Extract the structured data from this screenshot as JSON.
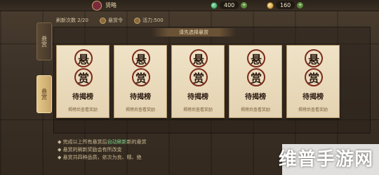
{
  "topbar": {
    "player_name": "贤略",
    "resources": [
      {
        "icon": "jade-gem-icon",
        "value": "400"
      },
      {
        "icon": "coin-icon",
        "value": "160"
      }
    ]
  },
  "side_tabs": [
    {
      "label": "悬赏",
      "active": false
    },
    {
      "label": "悬赏",
      "active": true
    }
  ],
  "info": {
    "refresh_label": "刷新次数 2/20",
    "bounty_label": "悬赏令",
    "vigor_label": "活力:500"
  },
  "banner": "请先选择悬赏",
  "cards": [
    {
      "seal_top": "悬",
      "seal_bottom": "赏",
      "title": "待揭榜",
      "subtitle": "揭榜后查看奖励"
    },
    {
      "seal_top": "悬",
      "seal_bottom": "赏",
      "title": "待揭榜",
      "subtitle": "揭榜后查看奖励"
    },
    {
      "seal_top": "悬",
      "seal_bottom": "赏",
      "title": "待揭榜",
      "subtitle": "揭榜后查看奖励"
    },
    {
      "seal_top": "悬",
      "seal_bottom": "赏",
      "title": "待揭榜",
      "subtitle": "揭榜后查看奖励"
    },
    {
      "seal_top": "悬",
      "seal_bottom": "赏",
      "title": "待揭榜",
      "subtitle": "揭榜后查看奖励"
    }
  ],
  "notes": [
    {
      "prefix": "◆ 完成以上所有悬赏后",
      "highlight": "自动刷新",
      "suffix": "新的悬赏"
    },
    {
      "prefix": "◆ 悬赏的刷新奖励会有所改变",
      "highlight": "",
      "suffix": ""
    },
    {
      "prefix": "◆ 悬赏共四种品质，依次为良、精、绝",
      "highlight": "",
      "suffix": ""
    }
  ],
  "watermark": "维普手游网"
}
